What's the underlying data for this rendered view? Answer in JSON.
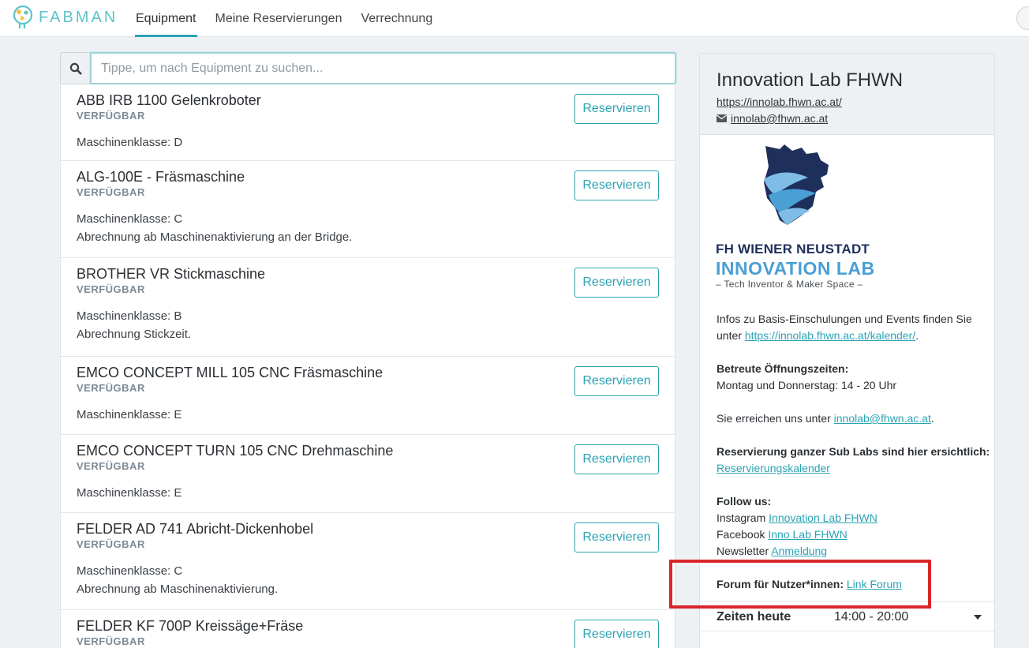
{
  "app": {
    "brand": "FABMAN"
  },
  "nav": {
    "tabs": [
      "Equipment",
      "Meine Reservierungen",
      "Verrechnung"
    ],
    "active": "Equipment"
  },
  "search": {
    "placeholder": "Tippe, um nach Equipment zu suchen...",
    "value": ""
  },
  "equipment": [
    {
      "name": "ABB IRB 1100 Gelenkroboter",
      "status": "VERFÜGBAR",
      "lines": [
        "Maschinenklasse: D"
      ],
      "button": "Reservieren"
    },
    {
      "name": "ALG-100E - Fräsmaschine",
      "status": "VERFÜGBAR",
      "lines": [
        "Maschinenklasse: C",
        "Abrechnung ab Maschinenaktivierung an der Bridge."
      ],
      "button": "Reservieren"
    },
    {
      "name": "BROTHER VR Stickmaschine",
      "status": "VERFÜGBAR",
      "lines": [
        "Maschinenklasse: B",
        "Abrechnung Stickzeit."
      ],
      "button": "Reservieren"
    },
    {
      "name": "EMCO CONCEPT MILL 105 CNC Fräsmaschine",
      "status": "VERFÜGBAR",
      "lines": [
        "Maschinenklasse: E"
      ],
      "button": "Reservieren"
    },
    {
      "name": "EMCO CONCEPT TURN 105 CNC Drehmaschine",
      "status": "VERFÜGBAR",
      "lines": [
        "Maschinenklasse: E"
      ],
      "button": "Reservieren"
    },
    {
      "name": "FELDER AD 741 Abricht-Dickenhobel",
      "status": "VERFÜGBAR",
      "lines": [
        "Maschinenklasse: C",
        "Abrechnung ab Maschinenaktivierung."
      ],
      "button": "Reservieren"
    },
    {
      "name": "FELDER KF 700P Kreissäge+Fräse",
      "status": "VERFÜGBAR",
      "lines": [],
      "button": "Reservieren"
    }
  ],
  "sidebar": {
    "title": "Innovation Lab FHWN",
    "url": "https://innolab.fhwn.ac.at/",
    "email": "innolab@fhwn.ac.at",
    "logo": {
      "line1": "FH WIENER NEUSTADT",
      "line2": "INNOVATION LAB",
      "line3": "–  Tech Inventor & Maker Space  –"
    },
    "info_text": "Infos zu Basis-Einschulungen und Events finden Sie unter",
    "info_link": "https://innolab.fhwn.ac.at/kalender/",
    "hours_heading": "Betreute Öffnungszeiten:",
    "hours_text": "Montag und Donnerstag: 14 - 20 Uhr",
    "contact_text": "Sie erreichen uns unter",
    "contact_link": "innolab@fhwn.ac.at",
    "sublabs_heading": "Reservierung ganzer Sub Labs sind hier ersichtlich:",
    "sublabs_link": "Reservierungskalender",
    "follow_heading": "Follow us:",
    "instagram_label": "Instagram",
    "instagram_link": "Innovation Lab FHWN",
    "facebook_label": "Facebook",
    "facebook_link": "Inno Lab FHWN",
    "newsletter_label": "Newsletter",
    "newsletter_link": "Anmeldung",
    "forum_label": "Forum für Nutzer*innen:",
    "forum_link": "Link Forum",
    "today_label": "Zeiten heute",
    "today_value": "14:00 - 20:00"
  },
  "colors": {
    "accent": "#2ba3b3",
    "highlight": "#d9262c",
    "logo_navy": "#1f2f5c",
    "logo_blue": "#4a9fd4"
  }
}
